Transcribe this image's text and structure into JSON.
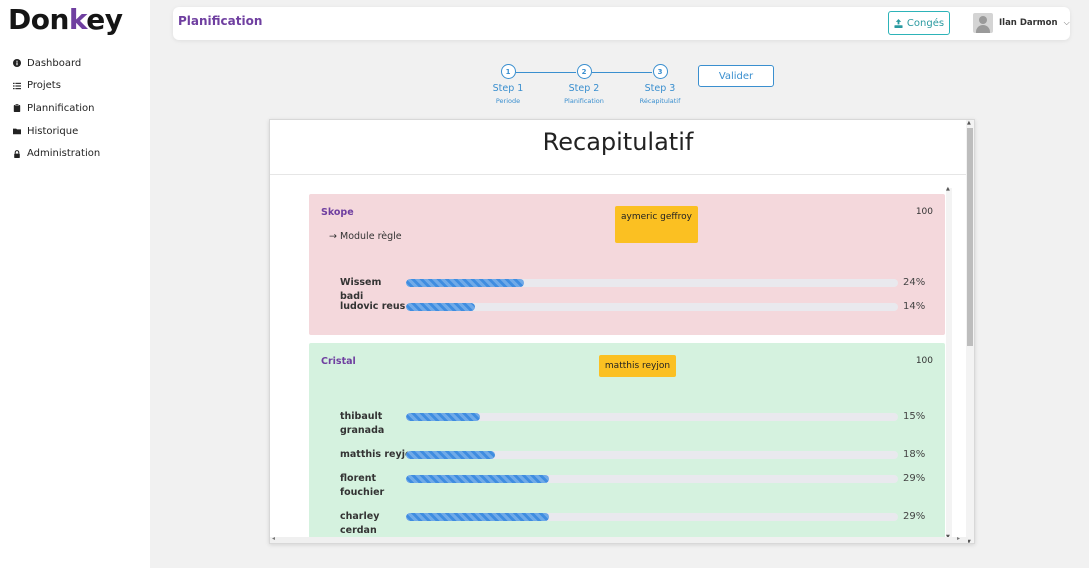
{
  "brand": {
    "pre": "Don",
    "accent": "k",
    "post": "ey"
  },
  "sidebar": {
    "items": [
      {
        "label": "Dashboard",
        "icon": "info-icon"
      },
      {
        "label": "Projets",
        "icon": "list-icon"
      },
      {
        "label": "Plannification",
        "icon": "clipboard-icon"
      },
      {
        "label": "Historique",
        "icon": "folder-icon"
      },
      {
        "label": "Administration",
        "icon": "lock-icon"
      }
    ]
  },
  "header": {
    "title": "Planification",
    "conges_label": "Congés",
    "user_name": "Ilan Darmon"
  },
  "stepper": {
    "steps": [
      {
        "number": "1",
        "title": "Step 1",
        "subtitle": "Periode"
      },
      {
        "number": "2",
        "title": "Step 2",
        "subtitle": "Planification"
      },
      {
        "number": "3",
        "title": "Step 3",
        "subtitle": "Récapitulatif"
      }
    ],
    "valider_label": "Valider"
  },
  "recap": {
    "title": "Recapitulatif",
    "projects": [
      {
        "name": "Skope",
        "chip": "aymeric geffroy",
        "total": "100",
        "module": "Module règle",
        "members": [
          {
            "name": "Wissem badi",
            "percent_label": "24%",
            "progress": 0.24
          },
          {
            "name": "ludovic reus",
            "percent_label": "14%",
            "progress": 0.14
          }
        ]
      },
      {
        "name": "Cristal",
        "chip": "matthis reyjon",
        "total": "100",
        "members": [
          {
            "name": "thibault granada",
            "percent_label": "15%",
            "progress": 0.15
          },
          {
            "name": "matthis reyjon",
            "percent_label": "18%",
            "progress": 0.18
          },
          {
            "name": "florent fouchier",
            "percent_label": "29%",
            "progress": 0.29
          },
          {
            "name": "charley cerdan",
            "percent_label": "29%",
            "progress": 0.29
          }
        ]
      }
    ]
  },
  "colors": {
    "brand_purple": "#6f3fa0",
    "accent_teal": "#2db3b8",
    "step_blue": "#3a8fcf",
    "progress_blue": "#3f8de0",
    "chip_yellow": "#fbc022",
    "card_pink": "#f4d8dc",
    "card_green": "#d5f2df"
  }
}
